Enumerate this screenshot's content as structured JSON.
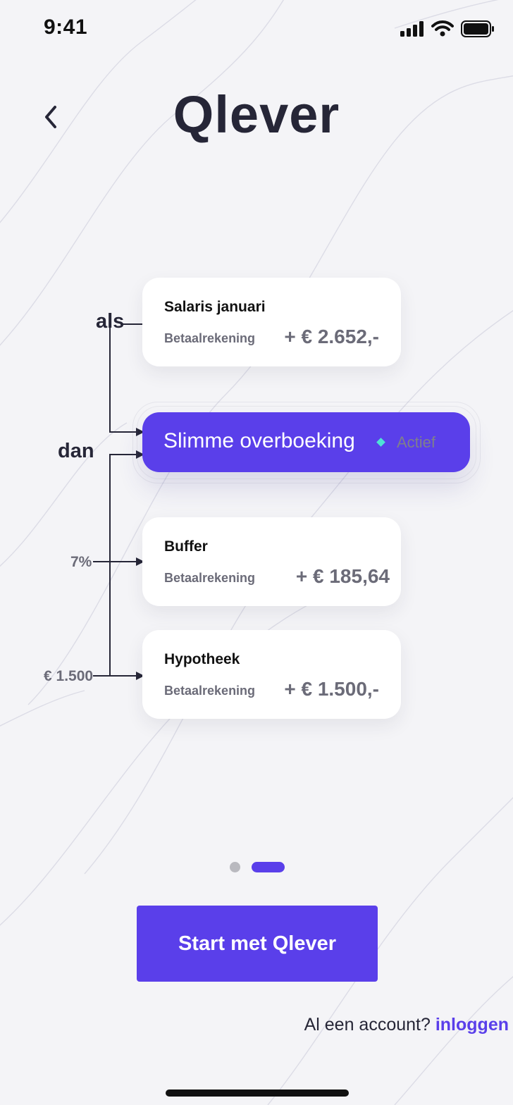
{
  "status_bar": {
    "time": "9:41"
  },
  "header": {
    "back_icon": "chevron-left-icon",
    "brand": "Qlever"
  },
  "flow": {
    "if_label": "als",
    "then_label": "dan",
    "trigger": {
      "title": "Salaris januari",
      "account": "Betaalrekening",
      "amount": "+ € 2.652,-"
    },
    "rule": {
      "title": "Slimme overboeking",
      "status": "Actief",
      "status_color": "#4ee2d5"
    },
    "targets": [
      {
        "condition": "7%",
        "title": "Buffer",
        "account": "Betaalrekening",
        "amount": "+ € 185,64"
      },
      {
        "condition": "€ 1.500",
        "title": "Hypotheek",
        "account": "Betaalrekening",
        "amount": "+ € 1.500,-"
      }
    ]
  },
  "pager": {
    "pages": 2,
    "active_index": 1
  },
  "cta": {
    "label": "Start met Qlever"
  },
  "login": {
    "prompt": "Al een account?",
    "link": "inloggen"
  },
  "colors": {
    "accent": "#5a3fea",
    "background": "#f4f4f7",
    "text": "#262637",
    "muted": "#6b6b78"
  }
}
